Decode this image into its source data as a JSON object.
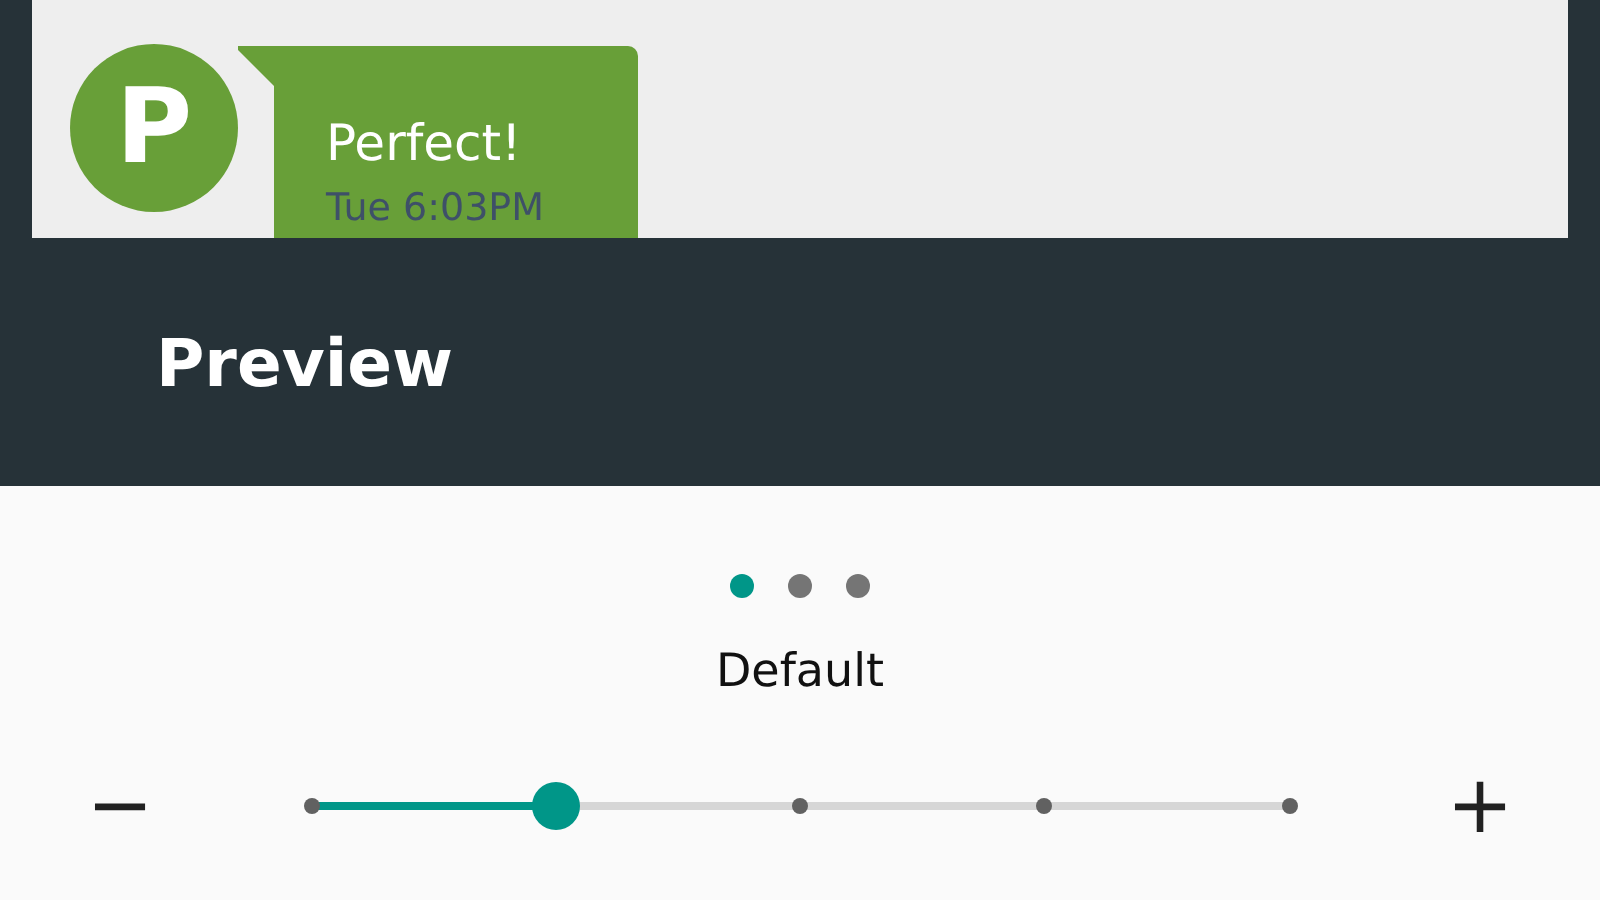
{
  "message": {
    "avatar_letter": "P",
    "text": "Perfect!",
    "time": "Tue 6:03PM"
  },
  "header": {
    "title": "Preview"
  },
  "page_dots": [
    {
      "selected": true
    },
    {
      "selected": false
    },
    {
      "selected": false
    }
  ],
  "size_label": "Default",
  "size_slider": {
    "decrease": "−",
    "increase": "+",
    "level": 0.25
  }
}
